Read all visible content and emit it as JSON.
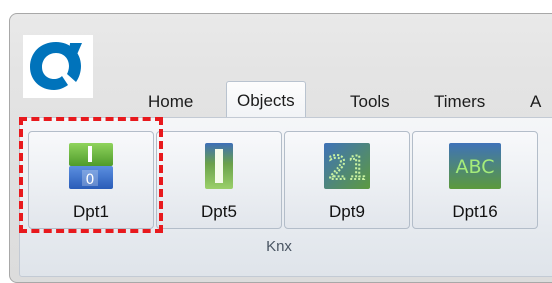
{
  "tabs": {
    "home": "Home",
    "objects": "Objects",
    "tools": "Tools",
    "timers": "Timers",
    "partial": "A"
  },
  "buttons": {
    "dpt1": {
      "label": "Dpt1",
      "icon": "switch-1-0-icon"
    },
    "dpt5": {
      "label": "Dpt5",
      "icon": "vertical-bar-icon"
    },
    "dpt9": {
      "label": "Dpt9",
      "icon": "number-21-icon"
    },
    "dpt16": {
      "label": "Dpt16",
      "icon": "text-abc-icon"
    }
  },
  "group": {
    "label": "Knx"
  },
  "colors": {
    "highlight": "#e8191d",
    "logo": "#0073bb",
    "active_tab_border": "#b9c3cf"
  }
}
